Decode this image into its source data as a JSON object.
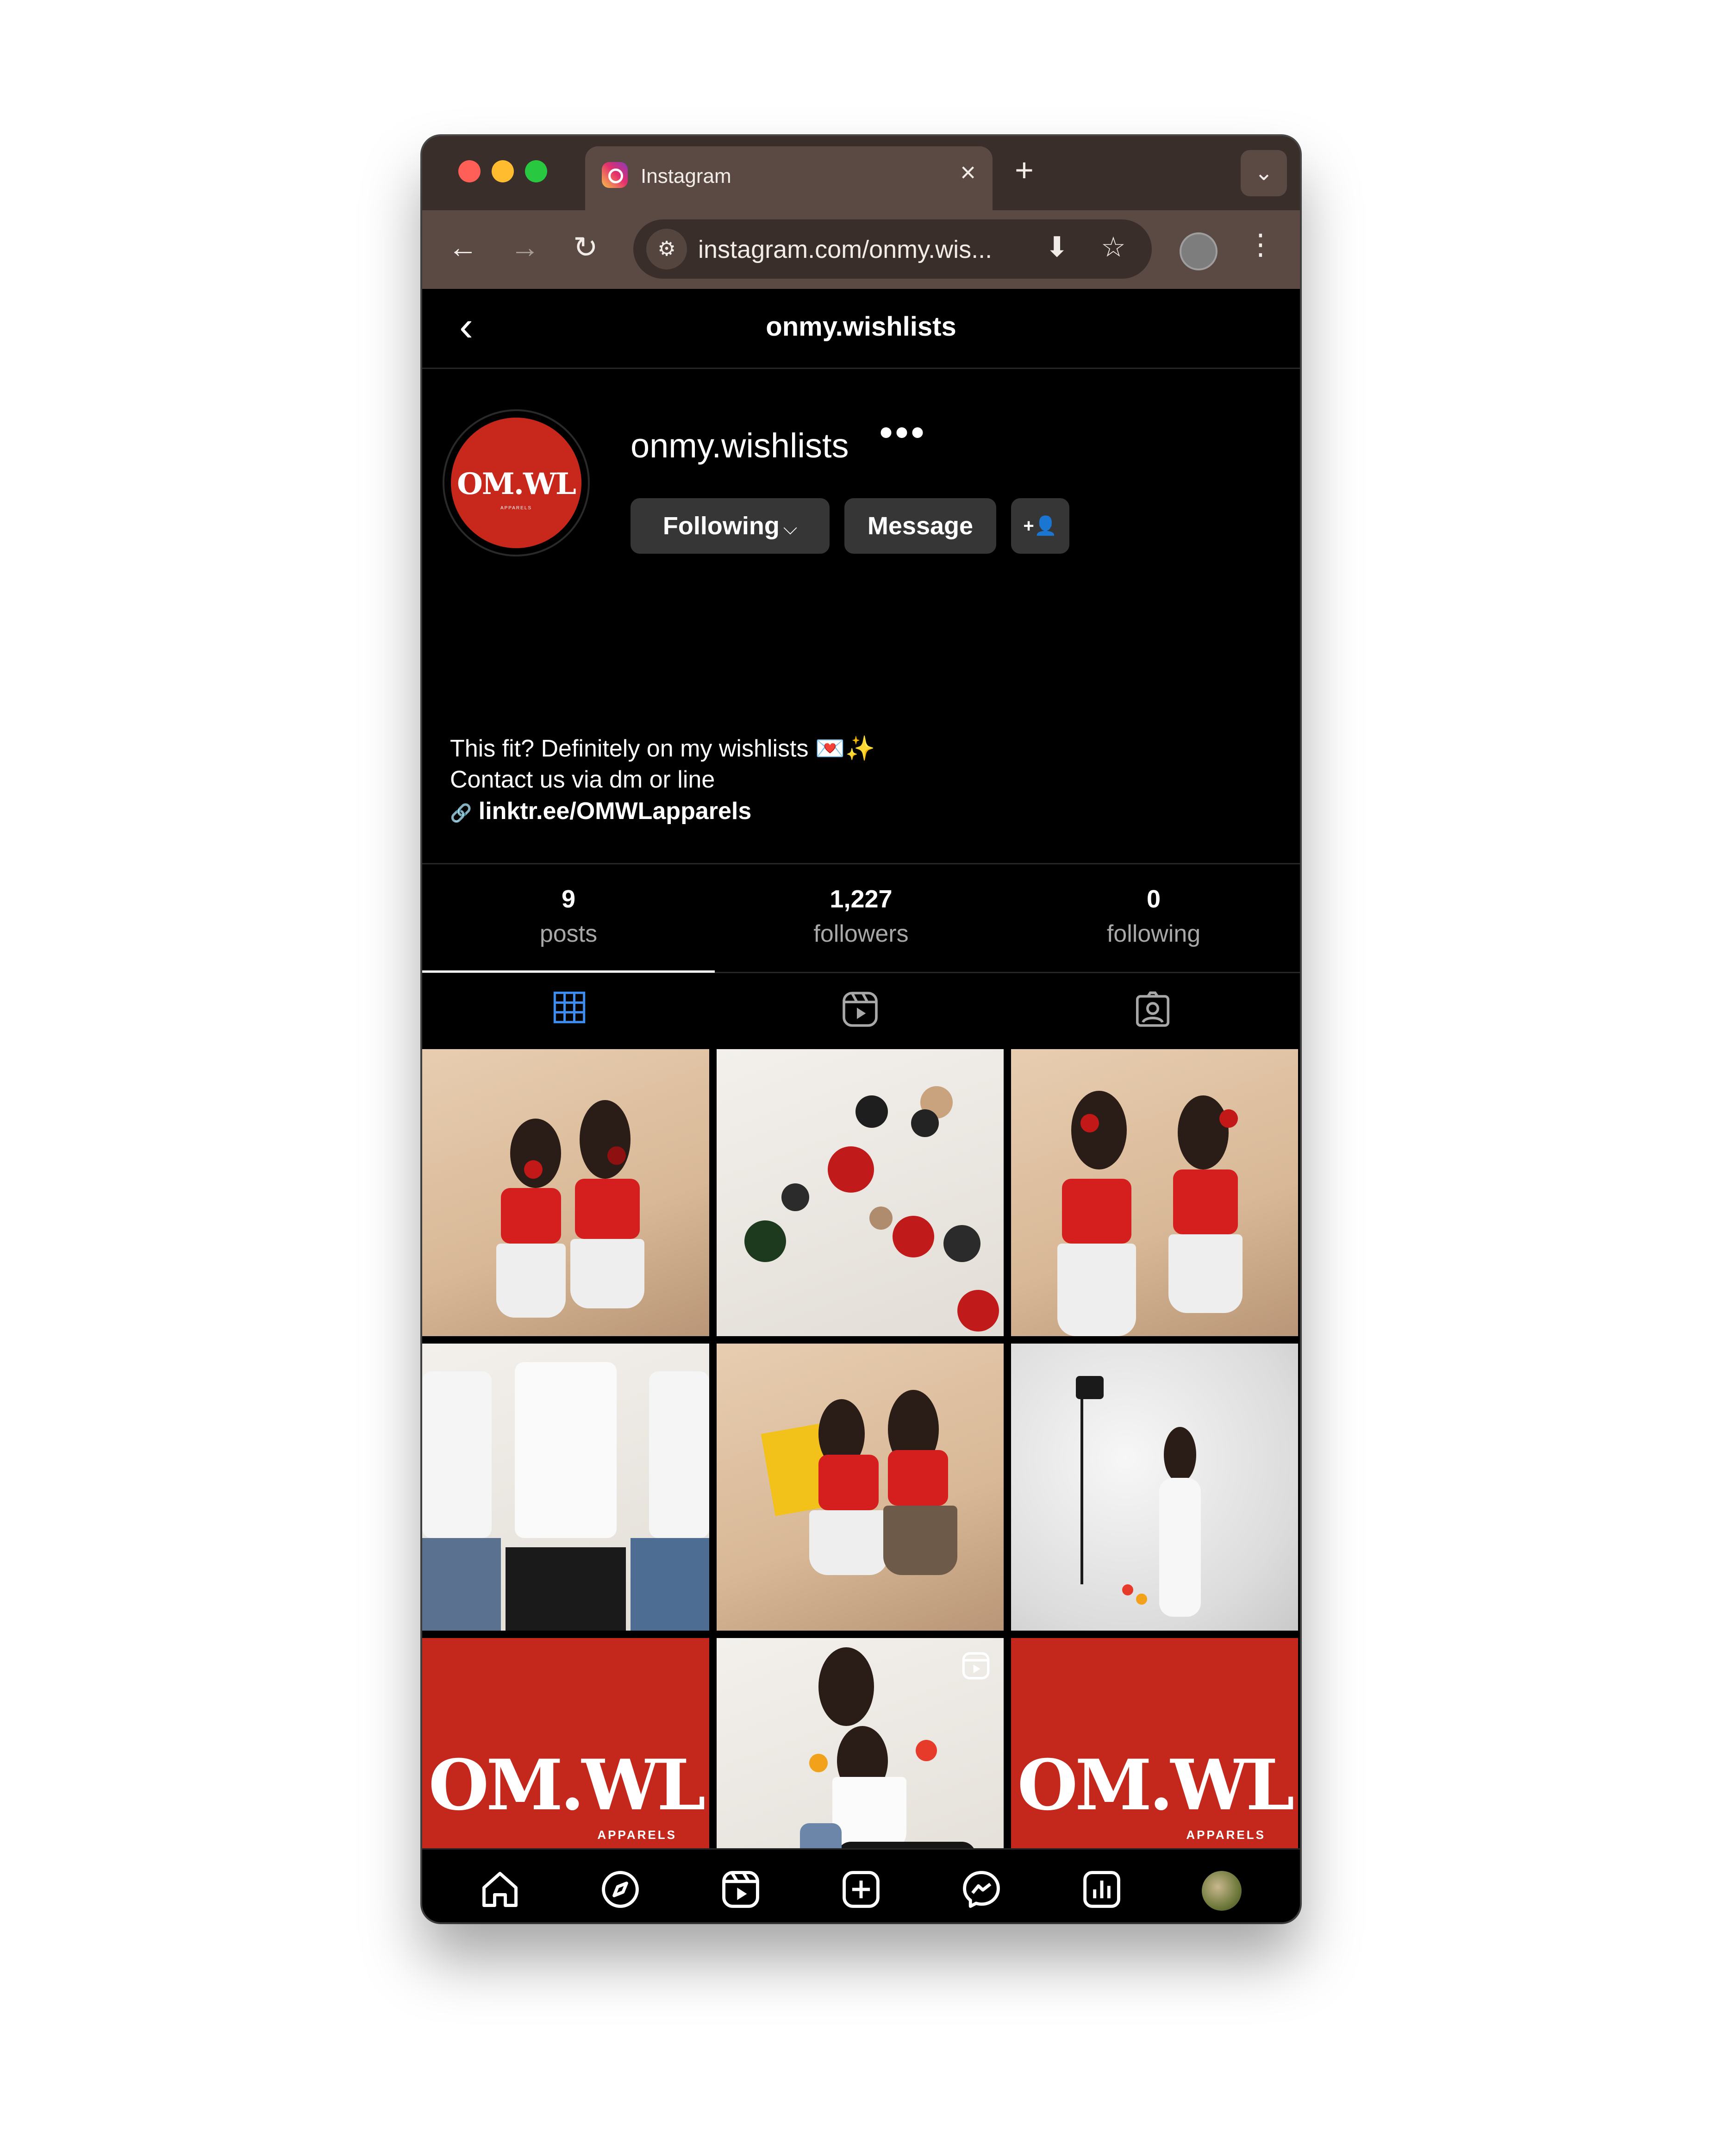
{
  "browser": {
    "tab_title": "Instagram",
    "tab_close": "×",
    "new_tab": "+",
    "tab_dropdown": "⌄",
    "url": "instagram.com/onmy.wis...",
    "icons": {
      "back": "←",
      "forward": "→",
      "reload": "↻",
      "site_info": "⚙",
      "install": "⬇",
      "bookmark": "☆",
      "menu": "⋮"
    }
  },
  "header": {
    "title": "onmy.wishlists",
    "back_glyph": "‹"
  },
  "profile": {
    "username": "onmy.wishlists",
    "more_glyph": "•••",
    "avatar_logo": "OM.WL",
    "avatar_sub": "APPARELS",
    "following_label": "Following",
    "following_chevron": "⌵",
    "message_label": "Message",
    "suggest_glyph": "+👤",
    "bio": {
      "line1": "This fit? Definitely on my wishlists 💌✨",
      "line2": "Contact us via dm or line",
      "link_glyph": "🔗",
      "link": "linktr.ee/OMWLapparels"
    }
  },
  "stats": [
    {
      "value": "9",
      "label": "posts"
    },
    {
      "value": "1,227",
      "label": "followers"
    },
    {
      "value": "0",
      "label": "following"
    }
  ],
  "tabs": [
    "posts-grid",
    "reels",
    "tagged"
  ],
  "logo_tile": {
    "text": "OM.WL",
    "sub": "APPARELS"
  },
  "colors": {
    "brand_red": "#c4281c",
    "tab_active": "#3d8cf0",
    "background": "#000000",
    "button": "#363636"
  }
}
